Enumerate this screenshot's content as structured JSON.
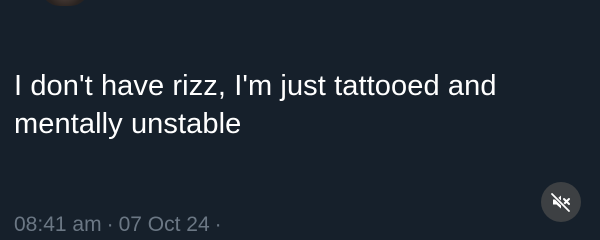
{
  "tweet": {
    "text_line1": "I don't have rizz, I'm just tattooed and",
    "text_line2": "mentally unstable"
  },
  "meta": {
    "time": "08:41 am",
    "separator": "·",
    "date": "07 Oct 24",
    "trailing_separator": "·"
  },
  "icons": {
    "mute": "speaker-muted-icon"
  },
  "colors": {
    "background": "#16202b",
    "text": "#ffffff",
    "meta_text": "#6b7784",
    "mute_button_bg": "#3d4043"
  }
}
